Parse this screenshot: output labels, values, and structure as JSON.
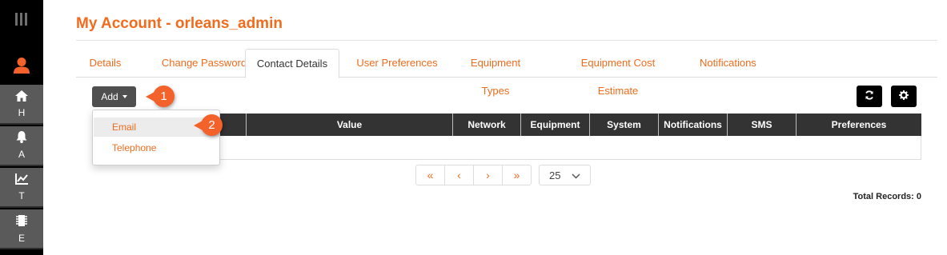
{
  "sidebar": {
    "items": [
      {
        "letter": "H",
        "icon": "home-icon"
      },
      {
        "letter": "A",
        "icon": "bell-icon"
      },
      {
        "letter": "T",
        "icon": "trend-chart-icon"
      },
      {
        "letter": "E",
        "icon": "chip-icon"
      }
    ]
  },
  "page": {
    "title": "My Account - orleans_admin"
  },
  "tabs": [
    {
      "label": "Details"
    },
    {
      "label": "Change Password"
    },
    {
      "label": "Contact Details"
    },
    {
      "label": "User Preferences"
    },
    {
      "label": "Equipment Types"
    },
    {
      "label": "Equipment Cost Estimate"
    },
    {
      "label": "Notifications"
    }
  ],
  "toolbar": {
    "add_label": "Add",
    "refresh_icon": "refresh-icon",
    "settings_icon": "gear-icon"
  },
  "callouts": {
    "first": "1",
    "second": "2"
  },
  "dropdown": {
    "items": [
      {
        "label": "Email"
      },
      {
        "label": "Telephone"
      }
    ]
  },
  "table": {
    "columns": [
      "Value",
      "Network",
      "Equipment",
      "System",
      "Notifications",
      "SMS",
      "Preferences"
    ]
  },
  "pagination": {
    "first": "«",
    "prev": "‹",
    "next": "›",
    "last": "»",
    "per_page": "25"
  },
  "footer": {
    "total_records": "Total Records: 0"
  },
  "colors": {
    "accent": "#f26b1d",
    "sidebar_bg": "#000000",
    "sidebar_item": "#5a5a5a",
    "table_header": "#333333",
    "callout": "#f4622c"
  }
}
